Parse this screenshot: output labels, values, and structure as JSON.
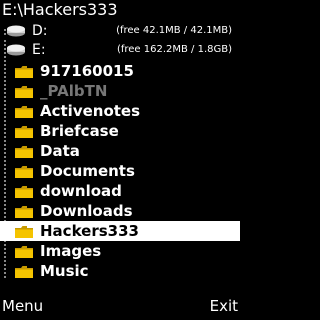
{
  "title": "E:\\Hackers333",
  "drives": [
    {
      "label": "D:",
      "free": "(free  42.1MB / 42.1MB)"
    },
    {
      "label": "E:",
      "free": "(free  162.2MB / 1.8GB)"
    }
  ],
  "folders": [
    {
      "label": "917160015",
      "dim": false,
      "selected": false
    },
    {
      "label": "_PAlbTN",
      "dim": true,
      "selected": false
    },
    {
      "label": "Activenotes",
      "dim": false,
      "selected": false
    },
    {
      "label": "Briefcase",
      "dim": false,
      "selected": false
    },
    {
      "label": "Data",
      "dim": false,
      "selected": false
    },
    {
      "label": "Documents",
      "dim": false,
      "selected": false
    },
    {
      "label": "download",
      "dim": false,
      "selected": false
    },
    {
      "label": "Downloads",
      "dim": false,
      "selected": false
    },
    {
      "label": "Hackers333",
      "dim": false,
      "selected": true
    },
    {
      "label": "Images",
      "dim": false,
      "selected": false
    },
    {
      "label": "Music",
      "dim": false,
      "selected": false
    }
  ],
  "softkeys": {
    "left": "Menu",
    "right": "Exit"
  },
  "colors": {
    "background": "#000000",
    "text": "#ffffff",
    "folder": "#f5c400",
    "selection": "#ffffff",
    "dim_text": "#777777"
  },
  "icons": {
    "drive": "drive-icon",
    "folder": "folder-icon"
  }
}
